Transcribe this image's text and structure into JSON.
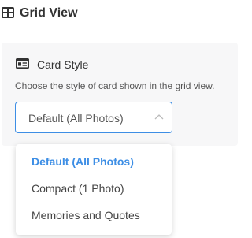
{
  "header": {
    "title": "Grid View",
    "icon": "grid-icon"
  },
  "card_style": {
    "icon": "id-card-icon",
    "title": "Card Style",
    "description": "Choose the style of card shown in the grid view.",
    "selected_value": "Default (All Photos)",
    "options": [
      {
        "label": "Default (All Photos)",
        "selected": true
      },
      {
        "label": "Compact (1 Photo)",
        "selected": false
      },
      {
        "label": "Memories and Quotes",
        "selected": false
      }
    ]
  },
  "colors": {
    "accent": "#3d8ee5",
    "text": "#333333",
    "panel_bg": "#f7f7f8"
  }
}
